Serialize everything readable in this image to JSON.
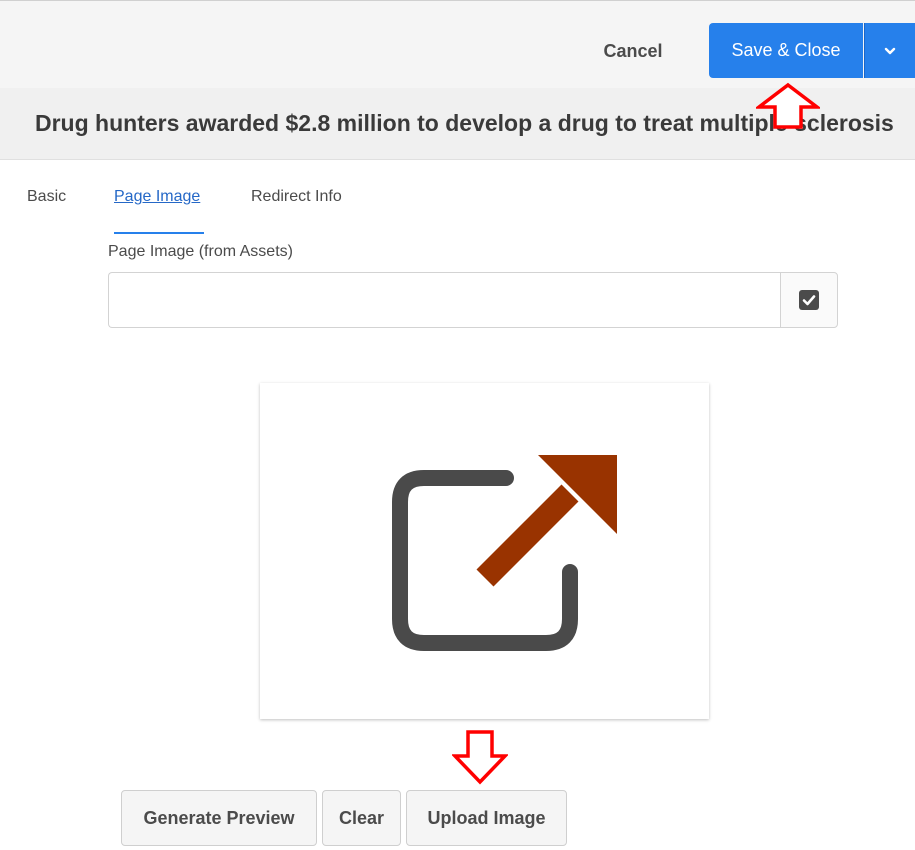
{
  "toolbar": {
    "cancel_label": "Cancel",
    "save_close_label": "Save & Close",
    "save_dropdown_icon": "chevron-down-icon"
  },
  "page": {
    "title": "Drug hunters awarded $2.8 million to develop a drug to treat multiple sclerosis"
  },
  "tabs": [
    {
      "label": "Basic",
      "active": false
    },
    {
      "label": "Page Image",
      "active": true
    },
    {
      "label": "Redirect Info",
      "active": false
    }
  ],
  "image_field": {
    "label": "Page Image (from Assets)",
    "value": "",
    "placeholder": "",
    "picker_icon": "checkbox-icon"
  },
  "preview": {
    "icon": "external-link-icon",
    "colors": {
      "frame": "#4a4a4a",
      "arrow": "#993300"
    }
  },
  "actions": {
    "generate_preview_label": "Generate Preview",
    "clear_label": "Clear",
    "upload_image_label": "Upload Image"
  },
  "annotations": {
    "arrow_color": "#ff0000"
  },
  "colors": {
    "accent": "#2680eb",
    "active_tab_text": "#2568c7"
  }
}
